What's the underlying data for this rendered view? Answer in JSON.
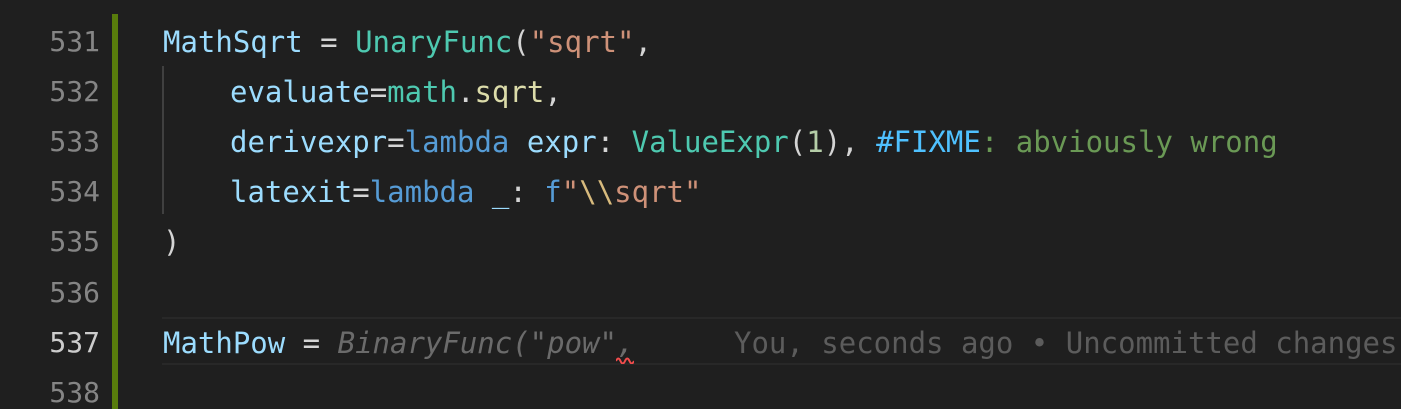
{
  "gutter": {
    "lines": [
      "531",
      "532",
      "533",
      "534",
      "535",
      "536",
      "537",
      "538"
    ],
    "active_line": "537"
  },
  "code": {
    "l531": {
      "ident": "MathSqrt",
      "eq": " = ",
      "cls": "UnaryFunc",
      "paren": "(",
      "str": "\"sqrt\"",
      "comma": ","
    },
    "l532": {
      "param": "evaluate",
      "eq": "=",
      "mod": "math",
      "dot": ".",
      "fn": "sqrt",
      "comma": ","
    },
    "l533": {
      "param": "derivexpr",
      "eq": "=",
      "kw": "lambda",
      "arg": " expr",
      "colon": ": ",
      "cls": "ValueExpr",
      "open": "(",
      "num": "1",
      "close": ")",
      "comma": ", ",
      "todo": "#FIXME",
      "comment": ": abviously wrong"
    },
    "l534": {
      "param": "latexit",
      "eq": "=",
      "kw": "lambda",
      "arg": " _",
      "colon": ": ",
      "prefix": "f",
      "quote_open": "\"",
      "esc": "\\\\",
      "str_rest": "sqrt\"",
      "str_text": "sqrt"
    },
    "l535": {
      "close": ")"
    },
    "l537": {
      "ident": "MathPow",
      "eq": " = ",
      "ghost": "BinaryFunc(\"pow\",",
      "blame": "You, seconds ago • Uncommitted changes"
    }
  },
  "colors": {
    "background": "#1f1f1f",
    "git_modified_bar": "#587c0c",
    "error_squiggle": "#f14c4c"
  }
}
